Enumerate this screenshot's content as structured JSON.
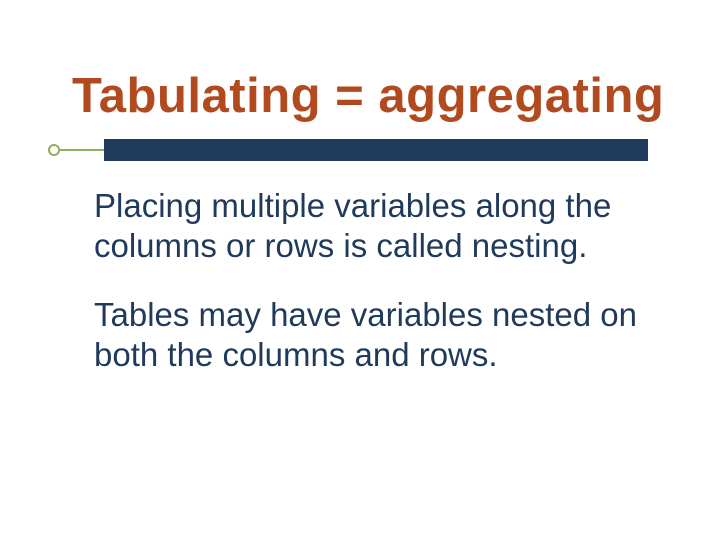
{
  "slide": {
    "title": "Tabulating = aggregating",
    "paragraphs": [
      "Placing multiple variables along the columns or rows is called nesting.",
      "Tables may have variables nested on both the columns and rows."
    ]
  }
}
